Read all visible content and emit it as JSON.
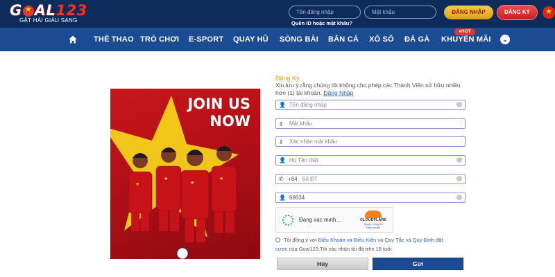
{
  "brand": {
    "logo_prefix": "G",
    "logo_suffix": "AL",
    "logo_number": "123",
    "slogan": "GẶT HÁI GIÀU SANG"
  },
  "header": {
    "username_placeholder": "Tên đăng nhập",
    "password_placeholder": "Mật khẩu",
    "login_label": "ĐĂNG NHẬP",
    "register_label": "ĐĂNG KÝ",
    "forgot_label": "Quên ID hoặc mật khẩu?",
    "flag_icon": "vietnam-flag-icon"
  },
  "nav": {
    "items": [
      "THỂ THAO",
      "TRÒ CHƠI",
      "E-SPORT",
      "QUAY HŨ",
      "SÒNG BÀI",
      "BẮN CÁ",
      "XỔ SỐ",
      "ĐÁ GÀ",
      "KHUYẾN MÃI"
    ],
    "hot_badge": "HOT"
  },
  "banner": {
    "line1": "JOIN US",
    "line2": "NOW"
  },
  "form": {
    "title": "Đăng Ký",
    "note": "Xin lưu ý rằng chúng tôi không cho phép các Thành Viên sở hữu nhiều hơn (1) tài khoản.",
    "note_link": "Đăng Nhập",
    "fields": {
      "username": "Tên đăng nhập",
      "password": "Mật khẩu",
      "confirm_password": "Xác nhận mật khẩu",
      "full_name": "Họ Tên thật",
      "phone_prefix": "+84",
      "phone": "Số ĐT",
      "referral": "68634"
    },
    "captcha": {
      "status": "Đang xác minh...",
      "brand": "CLOUDFLARE",
      "privacy": "Quyền riêng tư",
      "terms": "Điều khoản"
    },
    "terms": {
      "prefix": "Tôi đồng ý với",
      "link1": "Điều Khoản và Điều Kiện",
      "and": "và",
      "link2": "Quy Tắc và Quy Định đặt cược",
      "suffix": "của Goal123.Tôi xác nhận tôi đã trên 18 tuổi"
    },
    "cancel_label": "Hủy",
    "submit_label": "Gửi"
  },
  "colors": {
    "topbar": "#0d2c5c",
    "nav": "#1a4b93",
    "accent_orange": "#f29e1a",
    "brand_red": "#e6352b"
  }
}
